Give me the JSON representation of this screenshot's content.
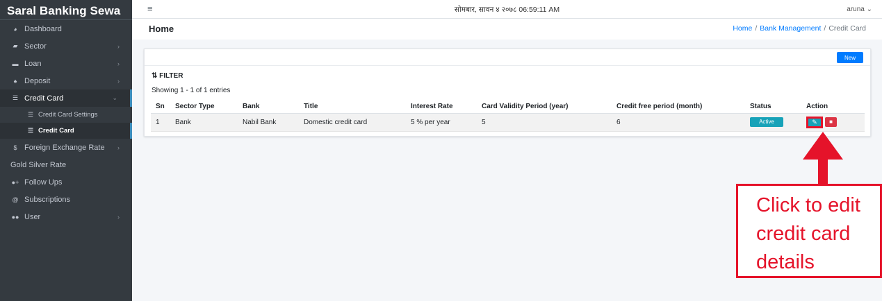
{
  "brand": "Saral Banking Sewa",
  "topbar": {
    "datetime": "सोमबार, सावन ४ २०७८ 06:59:11 AM",
    "user": "aruna ⌄"
  },
  "sidebar": {
    "items": [
      {
        "label": "Dashboard",
        "icon": "dashboard-icon"
      },
      {
        "label": "Sector",
        "icon": "sector-icon"
      },
      {
        "label": "Loan",
        "icon": "loan-icon"
      },
      {
        "label": "Deposit",
        "icon": "deposit-icon"
      },
      {
        "label": "Credit Card",
        "icon": "credit-card-icon"
      },
      {
        "label": "Credit Card Settings",
        "icon": "list-icon"
      },
      {
        "label": "Credit Card",
        "icon": "list-icon"
      },
      {
        "label": "Foreign Exchange Rate",
        "icon": "dollar-icon"
      },
      {
        "label": "Gold Silver Rate"
      },
      {
        "label": "Follow Ups",
        "icon": "user-plus-icon"
      },
      {
        "label": "Subscriptions",
        "icon": "at-icon"
      },
      {
        "label": "User",
        "icon": "users-icon"
      }
    ]
  },
  "header": {
    "title": "Home",
    "breadcrumb": [
      "Home",
      "Bank Management",
      "Credit Card"
    ]
  },
  "card": {
    "new_label": "New",
    "filter_label": "FILTER",
    "showing": "Showing 1 - 1 of 1 entries"
  },
  "table": {
    "columns": [
      "Sn",
      "Sector Type",
      "Bank",
      "Title",
      "Interest Rate",
      "Card Validity Period (year)",
      "Credit free period (month)",
      "Status",
      "Action"
    ],
    "rows": [
      {
        "sn": "1",
        "sector_type": "Bank",
        "bank": "Nabil Bank",
        "title": "Domestic credit card",
        "interest_rate": "5 % per year",
        "validity": "5",
        "credit_free": "6",
        "status": "Active"
      }
    ]
  },
  "annotation": {
    "line1": "Click to edit",
    "line2": "credit card",
    "line3": "details",
    "color": "#e5132a"
  }
}
